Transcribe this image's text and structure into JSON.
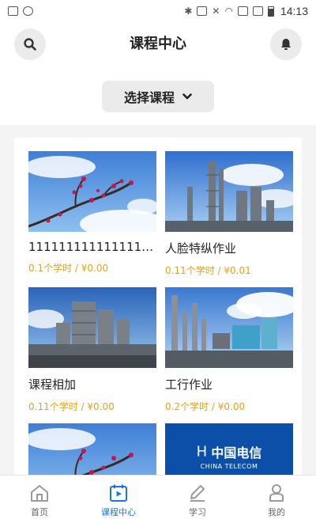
{
  "status_bar": {
    "time": "14:13",
    "icons": [
      "image-icon",
      "sync-icon",
      "bluetooth-icon",
      "nfc-icon",
      "mute-icon",
      "wifi-icon",
      "sim1-icon",
      "sim2-icon",
      "battery-icon"
    ]
  },
  "header": {
    "title": "课程中心",
    "search_icon": "search-icon",
    "bell_icon": "bell-icon"
  },
  "select_course": {
    "label": "选择课程",
    "icon": "chevron-down-icon"
  },
  "courses": [
    {
      "name": "1111111111111111...",
      "meta": "0.1个学时 / ¥0.00",
      "image": "plum-blossom"
    },
    {
      "name": "人脸特纵作业",
      "meta": "0.11个学时 / ¥0.01",
      "image": "refinery-towers"
    },
    {
      "name": "课程相加",
      "meta": "0.11个学时 / ¥0.00",
      "image": "industrial-plant"
    },
    {
      "name": "工行作业",
      "meta": "0.2个学时 / ¥0.00",
      "image": "chemical-plant-smoke"
    },
    {
      "name": "",
      "meta": "",
      "image": "plum-blossom"
    },
    {
      "name": "",
      "meta": "",
      "image": "china-telecom-logo",
      "logo_text": "中国电信",
      "logo_subtext": "CHINA TELECOM"
    }
  ],
  "bottom_nav": {
    "active_color": "#1a73e8",
    "items": [
      {
        "label": "首页",
        "icon": "home-icon"
      },
      {
        "label": "课程中心",
        "icon": "course-play-icon",
        "active": true
      },
      {
        "label": "学习",
        "icon": "pencil-icon"
      },
      {
        "label": "我的",
        "icon": "user-icon"
      }
    ]
  }
}
